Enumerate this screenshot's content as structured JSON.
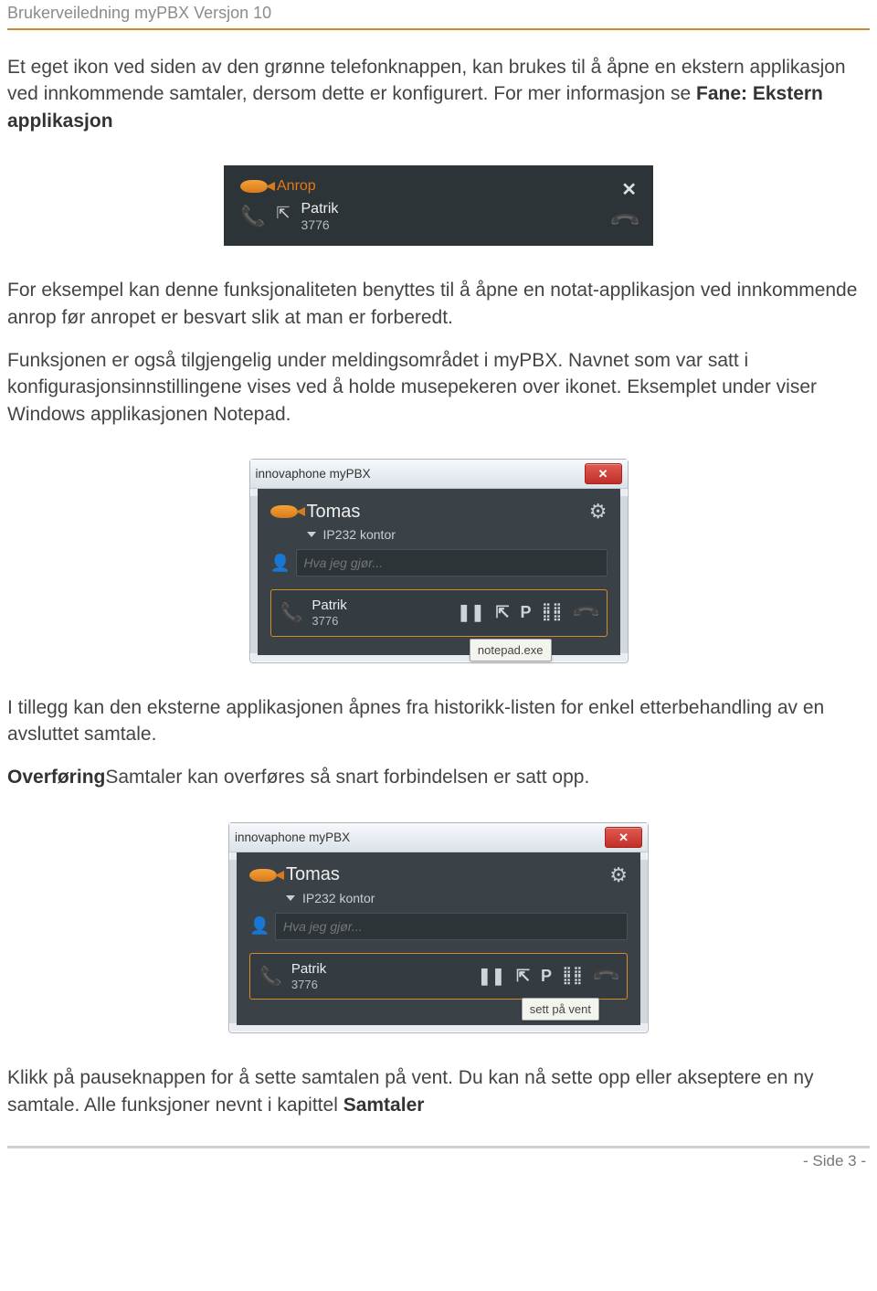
{
  "doc": {
    "header": "Brukerveiledning myPBX Versjon 10",
    "page_label": "- Side 3 -"
  },
  "p1a": "Et eget ikon ved siden av den grønne telefonknappen, kan brukes til å åpne en ekstern applikasjon ved innkommende samtaler, dersom dette er konfigurert. For mer informasjon se ",
  "p1b": "Fane: Ekstern applikasjon",
  "p2": "For eksempel kan denne funksjonaliteten benyttes til å åpne en notat-applikasjon ved innkommende anrop før anropet er besvart slik at man er forberedt.",
  "p3": "Funksjonen er også tilgjengelig under meldingsområdet i myPBX. Navnet som var satt i konfigurasjonsinnstillingene vises ved å holde musepekeren over ikonet. Eksemplet under viser Windows applikasjonen Notepad.",
  "p4": "I tillegg kan den eksterne applikasjonen åpnes fra historikk-listen for enkel etterbehandling av en avsluttet samtale.",
  "p5a": "Overføring",
  "p5b": "Samtaler kan overføres så snart forbindelsen er satt opp.",
  "p6a": "Klikk på pauseknappen for å sette samtalen på vent. Du kan nå sette opp eller akseptere en ny samtale. Alle funksjoner nevnt i kapittel ",
  "p6b": "Samtaler",
  "fig1": {
    "anrop": "Anrop",
    "name": "Patrik",
    "number": "3776"
  },
  "fig2": {
    "win_title": "innovaphone myPBX",
    "user": "Tomas",
    "device": "IP232 kontor",
    "status_placeholder": "Hva jeg gjør...",
    "call_name": "Patrik",
    "call_number": "3776",
    "action_p": "P",
    "tooltip": "notepad.exe"
  },
  "fig3": {
    "win_title": "innovaphone myPBX",
    "user": "Tomas",
    "device": "IP232 kontor",
    "status_placeholder": "Hva jeg gjør...",
    "call_name": "Patrik",
    "call_number": "3776",
    "action_p": "P",
    "tooltip": "sett på vent"
  }
}
